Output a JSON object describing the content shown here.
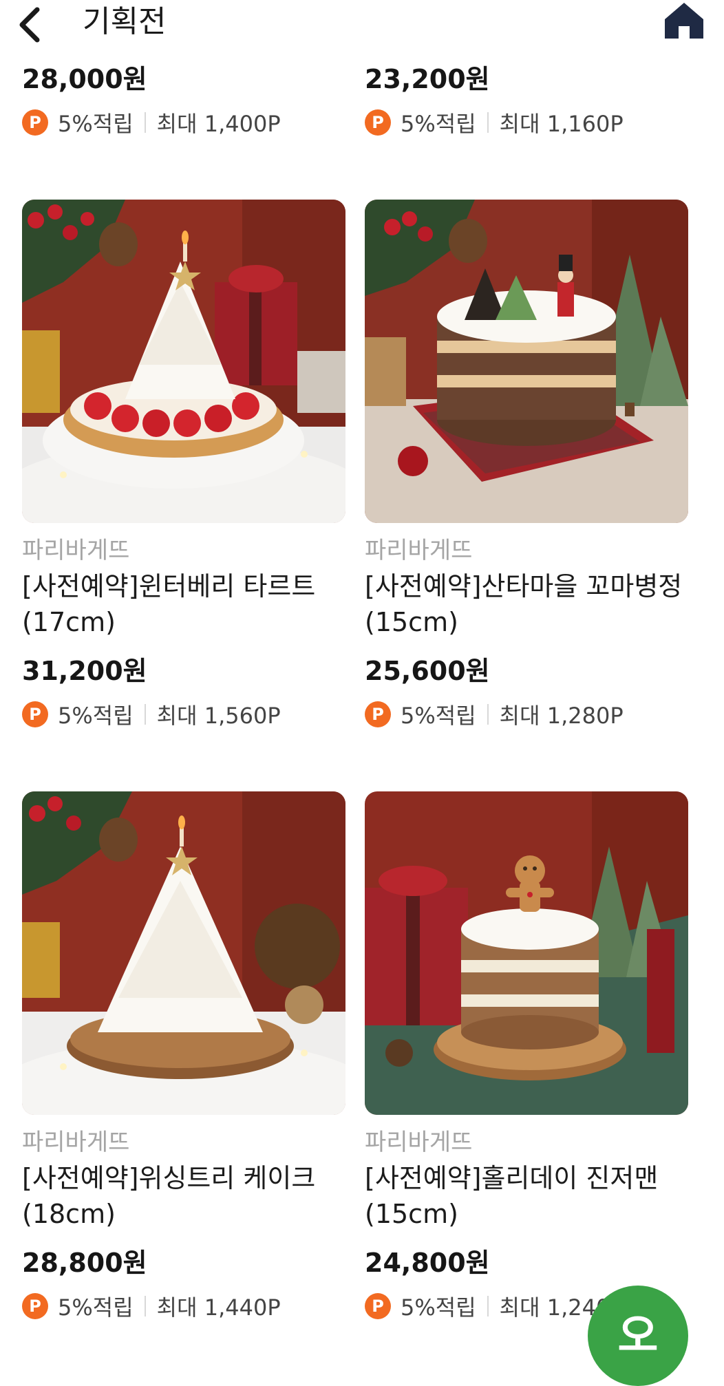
{
  "header": {
    "title": "기획전",
    "back_icon": "chevron-left-icon",
    "home_icon": "home-icon"
  },
  "colors": {
    "point_badge": "#f26a21",
    "fab": "#3aa346",
    "brand_text": "#a5a5a5"
  },
  "top_row": [
    {
      "price": "28,000원",
      "rate": "5%적립",
      "max": "최대 1,400P"
    },
    {
      "price": "23,200원",
      "rate": "5%적립",
      "max": "최대 1,160P"
    }
  ],
  "products": [
    {
      "brand": "파리바게뜨",
      "name": "[사전예약]윈터베리 타르트 (17cm)",
      "price": "31,200원",
      "rate": "5%적립",
      "max": "최대 1,560P"
    },
    {
      "brand": "파리바게뜨",
      "name": "[사전예약]산타마을 꼬마병정 (15cm)",
      "price": "25,600원",
      "rate": "5%적립",
      "max": "최대 1,280P"
    },
    {
      "brand": "파리바게뜨",
      "name": "[사전예약]위싱트리 케이크 (18cm)",
      "price": "28,800원",
      "rate": "5%적립",
      "max": "최대 1,440P"
    },
    {
      "brand": "파리바게뜨",
      "name": "[사전예약]홀리데이 진저맨 (15cm)",
      "price": "24,800원",
      "rate": "5%적립",
      "max": "최대 1,240P"
    }
  ],
  "point_badge_label": "P",
  "fab_label": "오"
}
